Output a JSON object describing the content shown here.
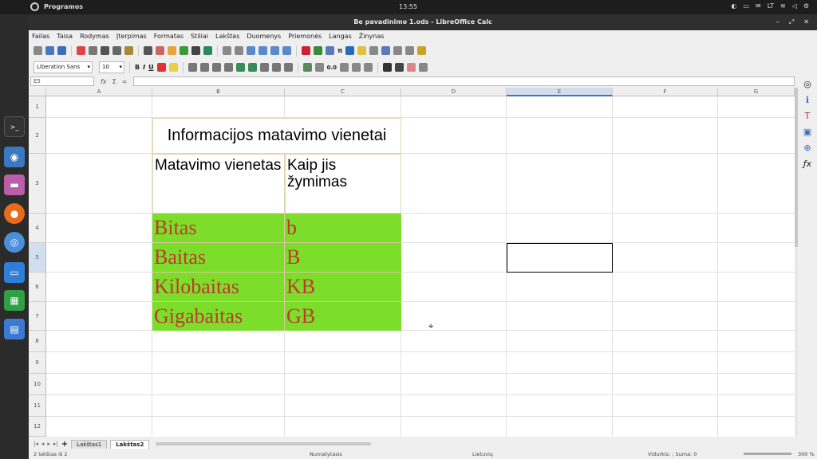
{
  "topbar": {
    "apps_label": "Programos",
    "clock": "13:55",
    "lang": "LT"
  },
  "window": {
    "title": "Be pavadinimo 1.ods - LibreOffice Calc"
  },
  "menu": [
    "Failas",
    "Taisa",
    "Rodymas",
    "Įterpimas",
    "Formatas",
    "Stiliai",
    "Lakštas",
    "Duomenys",
    "Priemonės",
    "Langas",
    "Žinynas"
  ],
  "toolbar": {
    "font_name": "Liberation Sans",
    "font_size": "10",
    "zero": "0.0"
  },
  "formula_bar": {
    "name_box": "E5",
    "fx": "fx",
    "sum": "Σ",
    "eq": "="
  },
  "columns": [
    "A",
    "B",
    "C",
    "D",
    "E",
    "F",
    "G"
  ],
  "rows": [
    "1",
    "2",
    "3",
    "4",
    "5",
    "6",
    "7",
    "8",
    "9",
    "10",
    "11",
    "12"
  ],
  "sheet": {
    "title": "Informacijos matavimo vienetai",
    "header_col1": "Matavimo vienetas",
    "header_col2": "Kaip jis žymimas",
    "units": [
      {
        "name": "Bitas",
        "symbol": "b"
      },
      {
        "name": "Baitas",
        "symbol": "B"
      },
      {
        "name": "Kilobaitas",
        "symbol": "KB"
      },
      {
        "name": "Gigabaitas",
        "symbol": "GB"
      }
    ]
  },
  "tabs": [
    "Lakštas1",
    "Lakštas2"
  ],
  "status": {
    "sheet_count": "2 lakštas iš 2",
    "style": "Numatytasis",
    "language": "Lietuvių",
    "aggregate": "Vidurkis: ; Suma: 0",
    "zoom": "300 %"
  },
  "colors": {
    "green_fill": "#7cdd2a",
    "red_text": "#c0392b",
    "selection": "#3b77c2"
  }
}
